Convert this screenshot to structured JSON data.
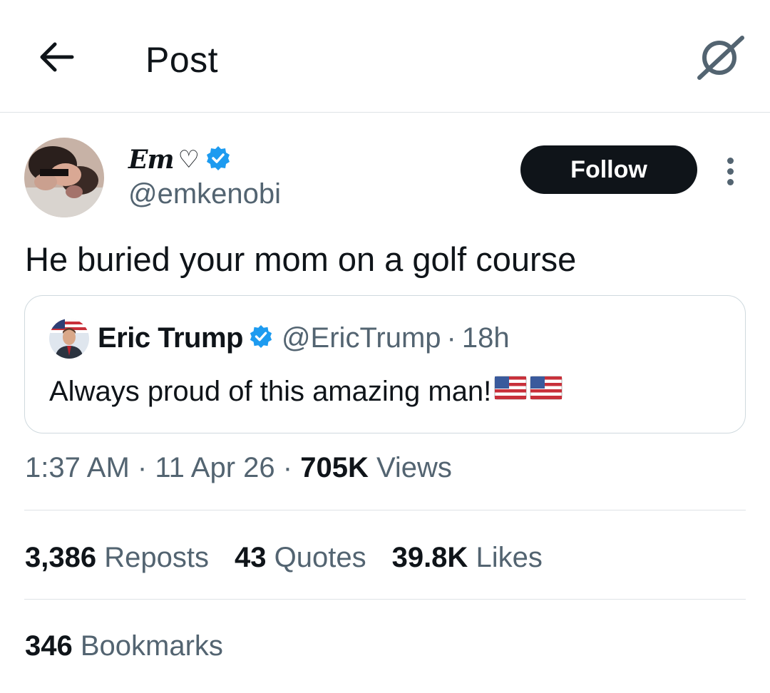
{
  "header": {
    "title": "Post",
    "back_icon": "arrow-left-icon",
    "grok_icon": "grok-icon"
  },
  "author": {
    "display_name": "Em",
    "name_suffix": "♡",
    "handle": "@emkenobi",
    "verified": true,
    "verified_color": "#1d9bf0",
    "follow_label": "Follow"
  },
  "tweet": {
    "text": "He buried your mom on a golf course"
  },
  "quote": {
    "name": "Eric Trump",
    "handle": "@EricTrump",
    "separator": "·",
    "time": "18h",
    "text": "Always proud of this amazing man!",
    "emoji_icons": [
      "us-flag-icon",
      "us-flag-icon"
    ]
  },
  "meta": {
    "time": "1:37 AM",
    "sep1": "·",
    "date": "11 Apr 26",
    "sep2": "·",
    "views_count": "705K",
    "views_label": "Views"
  },
  "stats": {
    "reposts_count": "3,386",
    "reposts_label": "Reposts",
    "quotes_count": "43",
    "quotes_label": "Quotes",
    "likes_count": "39.8K",
    "likes_label": "Likes"
  },
  "bookmarks": {
    "count": "346",
    "label": "Bookmarks"
  },
  "colors": {
    "text": "#0f1419",
    "secondary": "#536471",
    "border": "#cfd9de",
    "accent": "#1d9bf0",
    "button_bg": "#0f1419"
  }
}
